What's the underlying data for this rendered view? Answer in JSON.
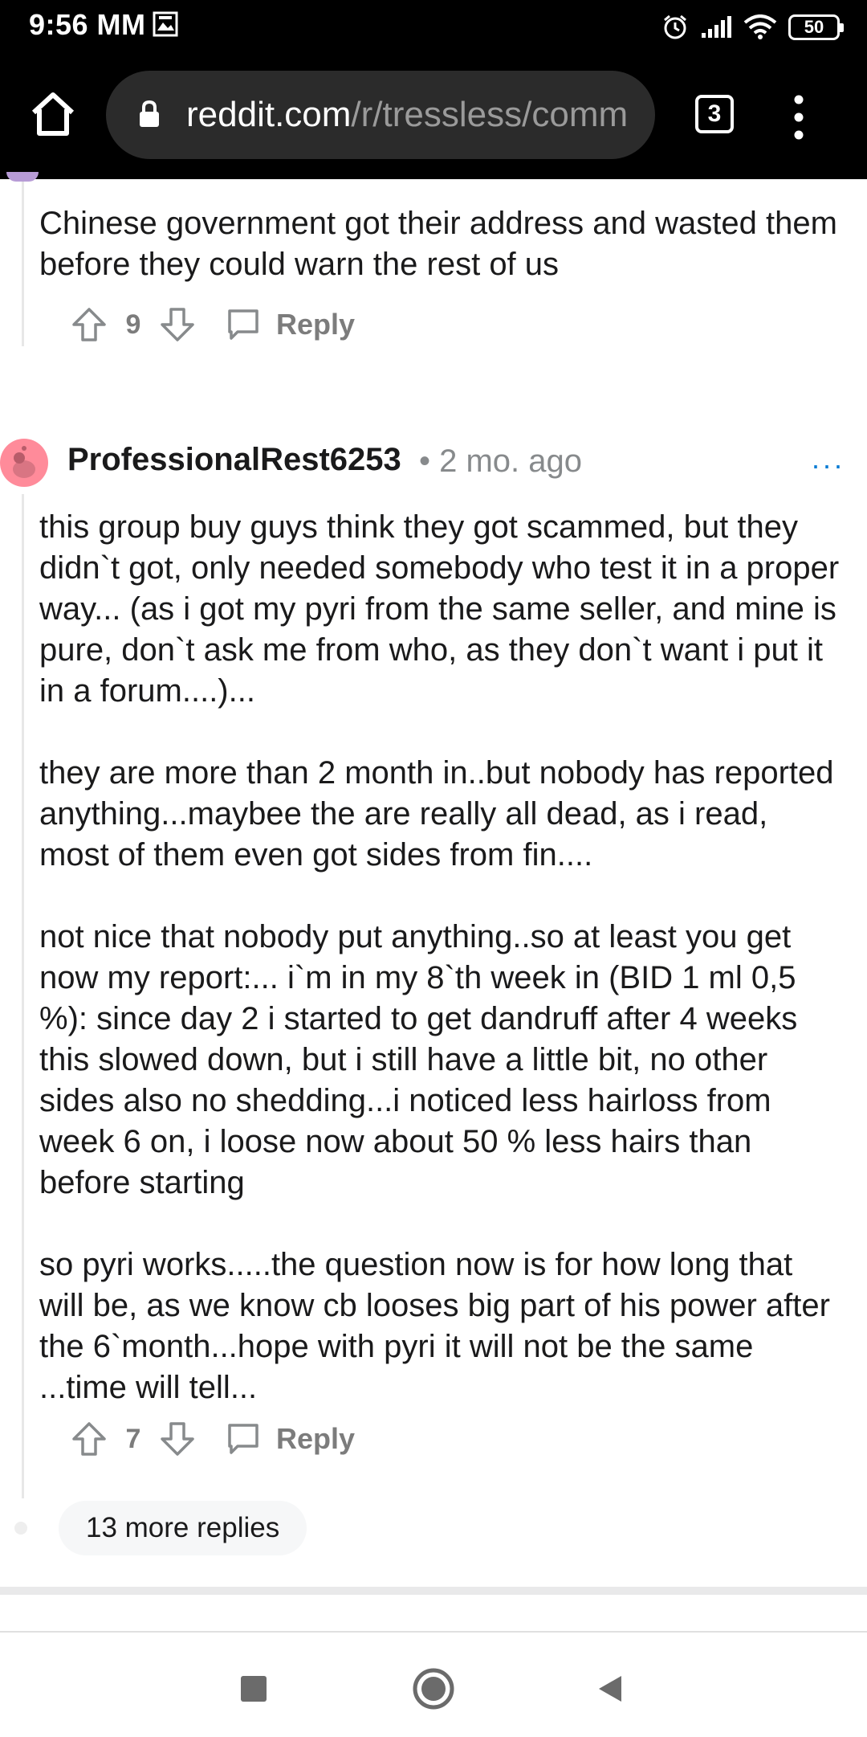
{
  "status_bar": {
    "time": "9:56 MM",
    "battery": "50",
    "icons": [
      "notification-image-icon",
      "alarm-icon",
      "signal-icon",
      "wifi-icon",
      "battery-icon"
    ]
  },
  "browser": {
    "url_domain": "reddit.com",
    "url_path": "/r/tressless/comm",
    "tab_count": "3",
    "icons": [
      "home-icon",
      "lock-icon",
      "menu-dots-icon"
    ]
  },
  "prev_comment": {
    "text": "Chinese government got their address and wasted them before they could warn the rest of us",
    "votes": "9",
    "reply_label": "Reply"
  },
  "comment": {
    "username": "ProfessionalRest6253",
    "meta": "• 2 mo. ago",
    "more_options": "···",
    "paragraphs": [
      "this group buy guys think they got scammed, but they didn`t got, only needed somebody who test it in a proper way... (as i got my pyri from the same seller, and mine is pure, don`t ask me from who, as they don`t want i put it in a forum....)...",
      "they are more than 2 month in..but nobody has reported anything...maybee the are really all dead, as i read, most of them even got sides from fin....",
      "not nice that nobody put anything..so at least you get now my report:... i`m in my 8`th week in (BID 1 ml 0,5 %): since day 2 i started to get dandruff after 4 weeks this slowed down, but i still have a little bit, no other sides also no shedding...i noticed less hairloss from week 6 on, i loose now about 50 % less hairs than before starting",
      "so pyri works.....the question now is for how long that will be, as we know cb looses big part of his power after the 6`month...hope with pyri it will not be the same ...time will tell..."
    ],
    "votes": "7",
    "reply_label": "Reply"
  },
  "more_replies": "13 more replies",
  "colors": {
    "accent": "#0079d3",
    "meta_gray": "#878a8c",
    "avatar_bg": "#ff8b9a"
  }
}
